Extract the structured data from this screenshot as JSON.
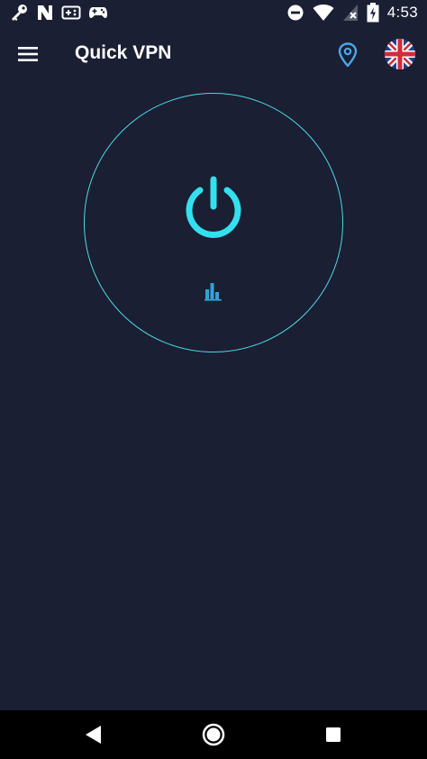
{
  "status_bar": {
    "time": "4:53",
    "left_icons": [
      "key-icon",
      "n-notification-icon",
      "gamepad-icon",
      "controller-icon"
    ],
    "right_icons": [
      "do-not-disturb-icon",
      "wifi-icon",
      "no-signal-icon",
      "battery-charging-icon"
    ]
  },
  "app_bar": {
    "title": "Quick VPN",
    "menu_icon": "hamburger-menu-icon",
    "location_icon": "location-pin-icon",
    "flag_icon": "uk-flag-icon"
  },
  "connect": {
    "power_icon": "power-icon",
    "stats_icon": "bar-chart-icon"
  },
  "colors": {
    "background": "#1a1f33",
    "accent": "#33e0ef",
    "ring": "#4fd8e6",
    "location": "#4aa8e8",
    "stats": "#2fa3d6"
  },
  "nav_bar": {
    "back_icon": "back-triangle-icon",
    "home_icon": "home-circle-icon",
    "recents_icon": "recents-square-icon"
  }
}
